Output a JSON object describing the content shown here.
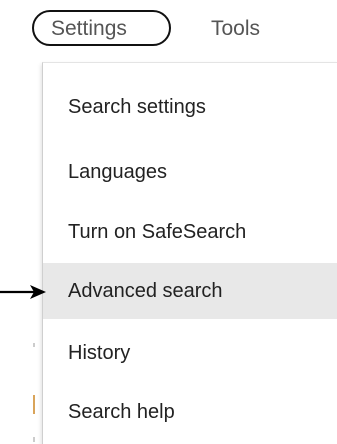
{
  "topbar": {
    "tabs": [
      {
        "label": "Settings",
        "active": true
      },
      {
        "label": "Tools",
        "active": false
      }
    ]
  },
  "menu": {
    "items": [
      {
        "label": "Search settings",
        "highlighted": false
      },
      {
        "label": "Languages",
        "highlighted": false
      },
      {
        "label": "Turn on SafeSearch",
        "highlighted": false
      },
      {
        "label": "Advanced search",
        "highlighted": true
      },
      {
        "label": "History",
        "highlighted": false
      },
      {
        "label": "Search help",
        "highlighted": false
      }
    ],
    "highlight_color": "#e8e8e8"
  },
  "annotation": {
    "arrow_icon": "right-arrow-icon",
    "points_to": "Advanced search",
    "color": "#000000"
  },
  "accent": {
    "outline_color": "#111111",
    "edge_mark_color": "#d9a45a"
  }
}
